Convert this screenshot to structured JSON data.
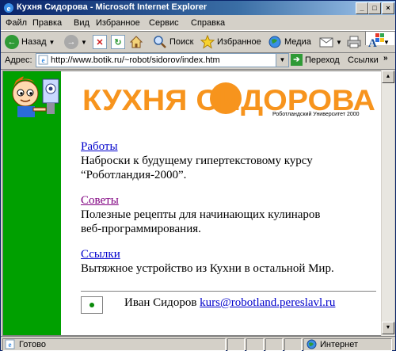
{
  "window": {
    "title": "Кухня Сидорова - Microsoft Internet Explorer"
  },
  "menu": [
    {
      "label": "Файл"
    },
    {
      "label": "Правка"
    },
    {
      "label": "Вид"
    },
    {
      "label": "Избранное"
    },
    {
      "label": "Сервис"
    },
    {
      "label": "Справка"
    }
  ],
  "toolbar": {
    "back_label": "Назад",
    "search_label": "Поиск",
    "favorites_label": "Избранное",
    "media_label": "Медиа"
  },
  "address": {
    "label": "Адрес:",
    "url": "http://www.botik.ru/~robot/sidorov/index.htm",
    "go_label": "Переход",
    "links_label": "Ссылки"
  },
  "page": {
    "logo_text": "КУХНЯ СИДОРОВА",
    "logo_subtitle": "Роботландский Университет 2000",
    "sections": [
      {
        "link": "Работы",
        "text": "Наброски к будущему гипертекстовому курсу “Роботландия-2000”."
      },
      {
        "link": "Советы",
        "text": "Полезные рецепты для начинающих кулинаров веб-программирования."
      },
      {
        "link": "Ссылки",
        "text": "Вытяжное устройство из Кухни в остальной Мир."
      }
    ],
    "footer_name": "Иван Сидоров",
    "footer_email": "kurs@robotland.pereslavl.ru"
  },
  "status": {
    "text": "Готово",
    "zone": "Интернет"
  },
  "colors": {
    "title_bar": "#0a246a",
    "sidebar": "#00a000",
    "logo_orange": "#f7941d",
    "link": "#0000cc",
    "visited_link": "#800080"
  }
}
